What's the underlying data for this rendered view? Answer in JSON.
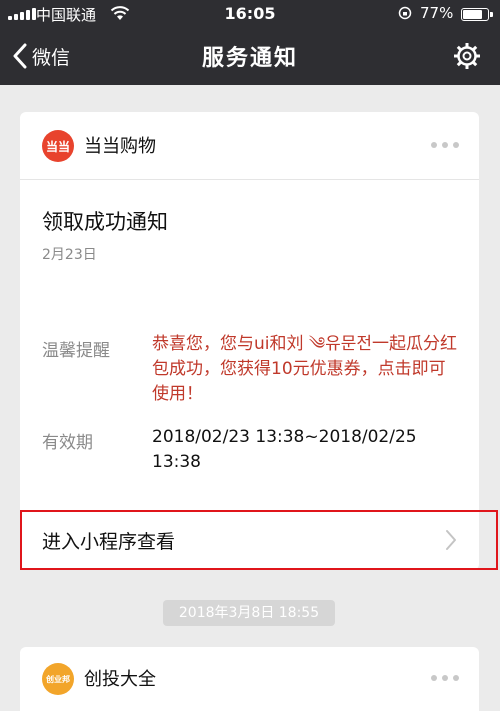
{
  "status_bar": {
    "carrier": "中国联通",
    "time": "16:05",
    "battery": "77%",
    "battery_level": 0.77
  },
  "nav": {
    "back_label": "微信",
    "title": "服务通知"
  },
  "notification": {
    "app_logo_text": "当当",
    "app_name": "当当购物",
    "title": "领取成功通知",
    "date": "2月23日",
    "reminder_label": "温馨提醒",
    "reminder_text": "恭喜您，您与ui和刘 ༄유문전一起瓜分红包成功，您获得10元优惠券，点击即可使用！",
    "validity_label": "有效期",
    "validity_text": "2018/02/23 13:38~2018/02/25 13:38",
    "enter_label": "进入小程序查看"
  },
  "timestamp": "2018年3月8日 18:55",
  "notification2": {
    "app_logo_text": "创业邦",
    "app_name": "创投大全"
  },
  "colors": {
    "topbar": "#2e2e32",
    "reminder_text": "#c0392b",
    "highlight_box": "#e0151b",
    "dangdang_logo": "#e8432d"
  }
}
